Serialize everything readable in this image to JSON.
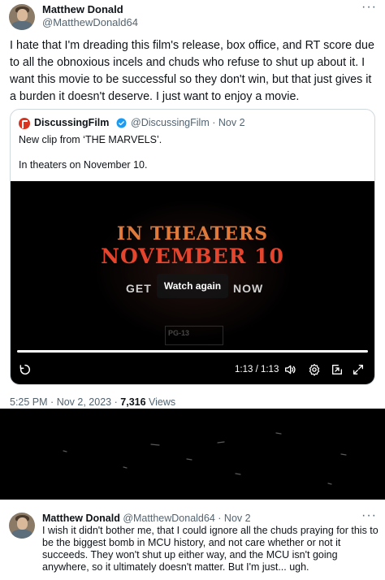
{
  "tweet": {
    "author_name": "Matthew Donald",
    "author_handle": "@MatthewDonald64",
    "more_label": "···",
    "text": "I hate that I'm dreading this film's release, box office, and RT score due to all the obnoxious incels and chuds who refuse to shut up about it. I want this movie to be successful so they don't win, but that just gives it a burden it doesn't deserve. I just want to enjoy a movie."
  },
  "quote": {
    "author_name": "DiscussingFilm",
    "author_handle": "@DiscussingFilm",
    "separator": "·",
    "date": "Nov 2",
    "text_line1": "New clip from ‘THE MARVELS’.",
    "text_line2": "In theaters on November 10.",
    "video": {
      "overlay_line1": "IN THEATERS",
      "overlay_line2": "NOVEMBER 10",
      "overlay_get": "GET",
      "overlay_now": "NOW",
      "watch_again_label": "Watch again",
      "rating_label": "PG-13",
      "time_display": "1:13 / 1:13",
      "progress": 1.0
    }
  },
  "meta": {
    "time": "5:25 PM",
    "separator": "·",
    "date": "Nov 2, 2023",
    "views_count": "7,316",
    "views_label": "Views"
  },
  "reply": {
    "author_name": "Matthew Donald",
    "author_handle": "@MatthewDonald64",
    "separator": "·",
    "date": "Nov 2",
    "more_label": "···",
    "text": "I wish it didn't bother me, that I could ignore all the chuds praying for this to be the biggest bomb in MCU history, and not care whether or not it succeeds. They won't shut up either way, and the MCU isn't going anywhere, so it ultimately doesn't matter. But I'm just... ugh."
  },
  "colors": {
    "text_primary": "#0f1419",
    "text_secondary": "#536471",
    "border": "#cfd9de",
    "verified_blue": "#1d9bf0",
    "discussingfilm_red": "#d9341f"
  },
  "icons": [
    "avatar",
    "more-icon",
    "verified-icon",
    "replay-icon",
    "volume-icon",
    "settings-icon",
    "pip-icon",
    "fullscreen-icon"
  ]
}
